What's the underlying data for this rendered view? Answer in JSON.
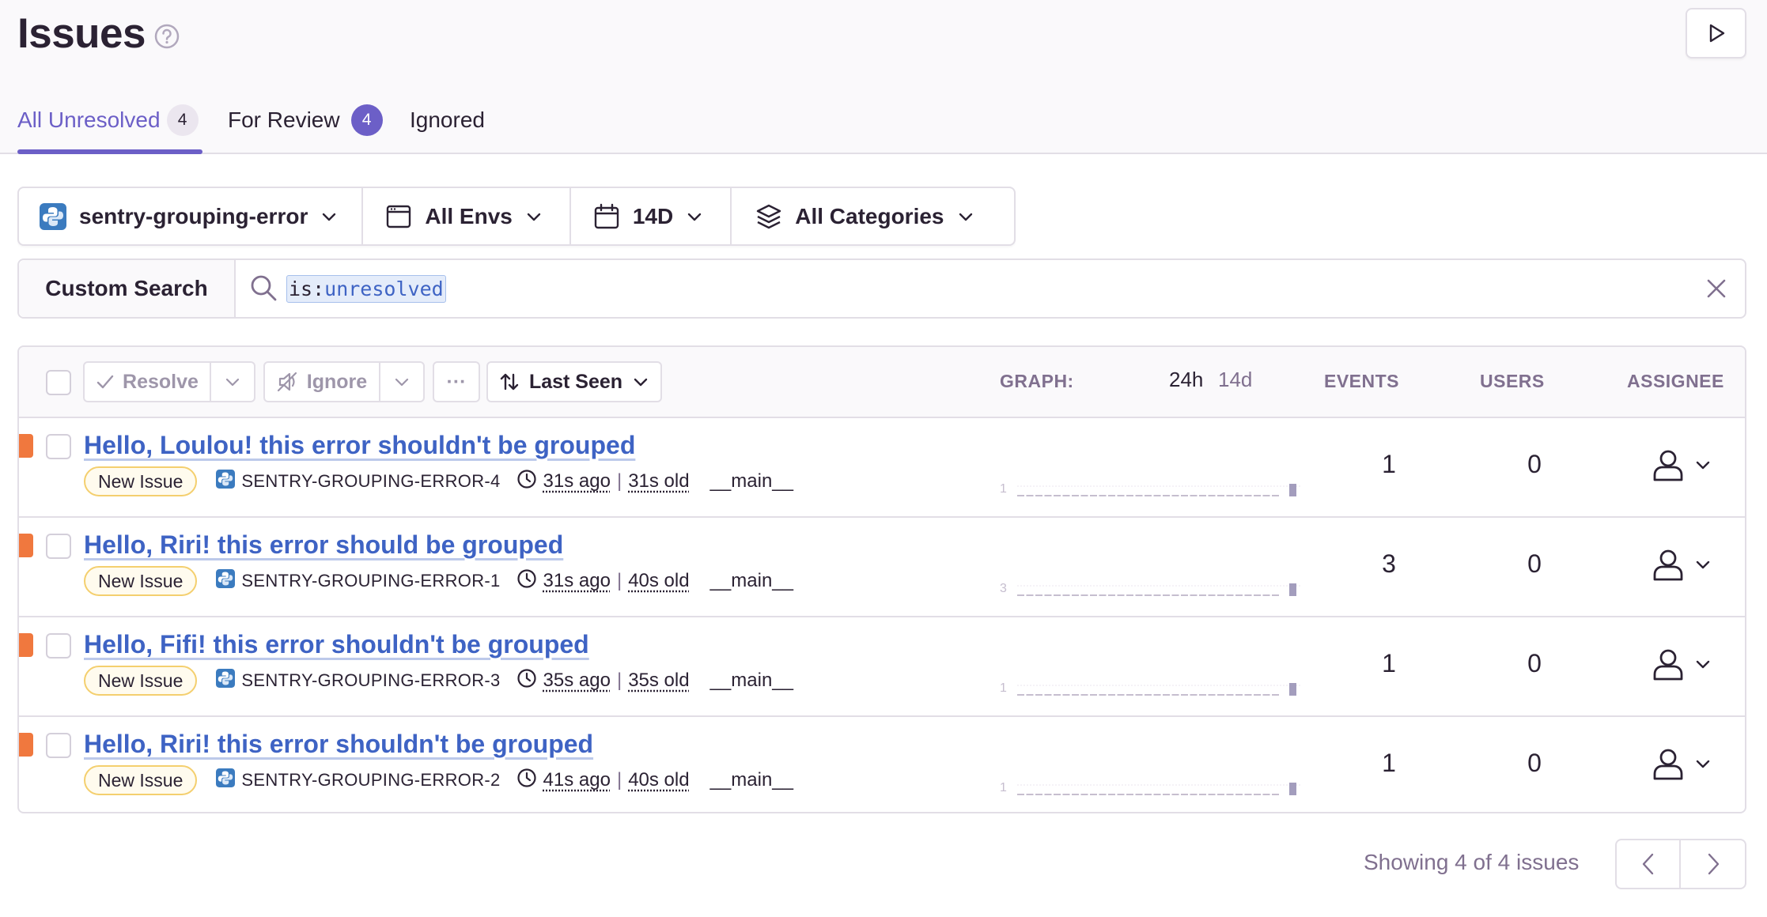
{
  "page": {
    "title": "Issues"
  },
  "tabs": [
    {
      "label": "All Unresolved",
      "count": "4",
      "active": true
    },
    {
      "label": "For Review",
      "count": "4"
    },
    {
      "label": "Ignored"
    }
  ],
  "filters": {
    "project": "sentry-grouping-error",
    "environment": "All Envs",
    "period": "14D",
    "categories": "All Categories"
  },
  "search": {
    "custom_label": "Custom Search",
    "token_key": "is:",
    "token_value": "unresolved"
  },
  "table": {
    "actions": {
      "resolve": "Resolve",
      "ignore": "Ignore",
      "more": "···",
      "sort": "Last Seen"
    },
    "columns": {
      "graph": "GRAPH:",
      "graph_24h": "24h",
      "graph_14d": "14d",
      "events": "EVENTS",
      "users": "USERS",
      "assignee": "ASSIGNEE"
    },
    "rows": [
      {
        "title": "Hello, Loulou! this error shouldn't be grouped",
        "badge": "New Issue",
        "short_id": "SENTRY-GROUPING-ERROR-4",
        "last_seen": "31s ago",
        "age": "31s old",
        "culprit": "__main__",
        "graph_max": "1",
        "graph_last": 1,
        "events": "1",
        "users": "0"
      },
      {
        "title": "Hello, Riri! this error should be grouped",
        "badge": "New Issue",
        "short_id": "SENTRY-GROUPING-ERROR-1",
        "last_seen": "31s ago",
        "age": "40s old",
        "culprit": "__main__",
        "graph_max": "3",
        "graph_last": 3,
        "events": "3",
        "users": "0"
      },
      {
        "title": "Hello, Fifi! this error shouldn't be grouped",
        "badge": "New Issue",
        "short_id": "SENTRY-GROUPING-ERROR-3",
        "last_seen": "35s ago",
        "age": "35s old",
        "culprit": "__main__",
        "graph_max": "1",
        "graph_last": 1,
        "events": "1",
        "users": "0"
      },
      {
        "title": "Hello, Riri! this error shouldn't be grouped",
        "badge": "New Issue",
        "short_id": "SENTRY-GROUPING-ERROR-2",
        "last_seen": "41s ago",
        "age": "40s old",
        "culprit": "__main__",
        "graph_max": "1",
        "graph_last": 1,
        "events": "1",
        "users": "0"
      }
    ]
  },
  "pagination": {
    "text": "Showing 4 of 4 issues"
  },
  "colors": {
    "accent": "#6c5fc7",
    "link": "#3e63c4",
    "level_error": "#f0783e",
    "badge_border": "#f4cf6e"
  }
}
